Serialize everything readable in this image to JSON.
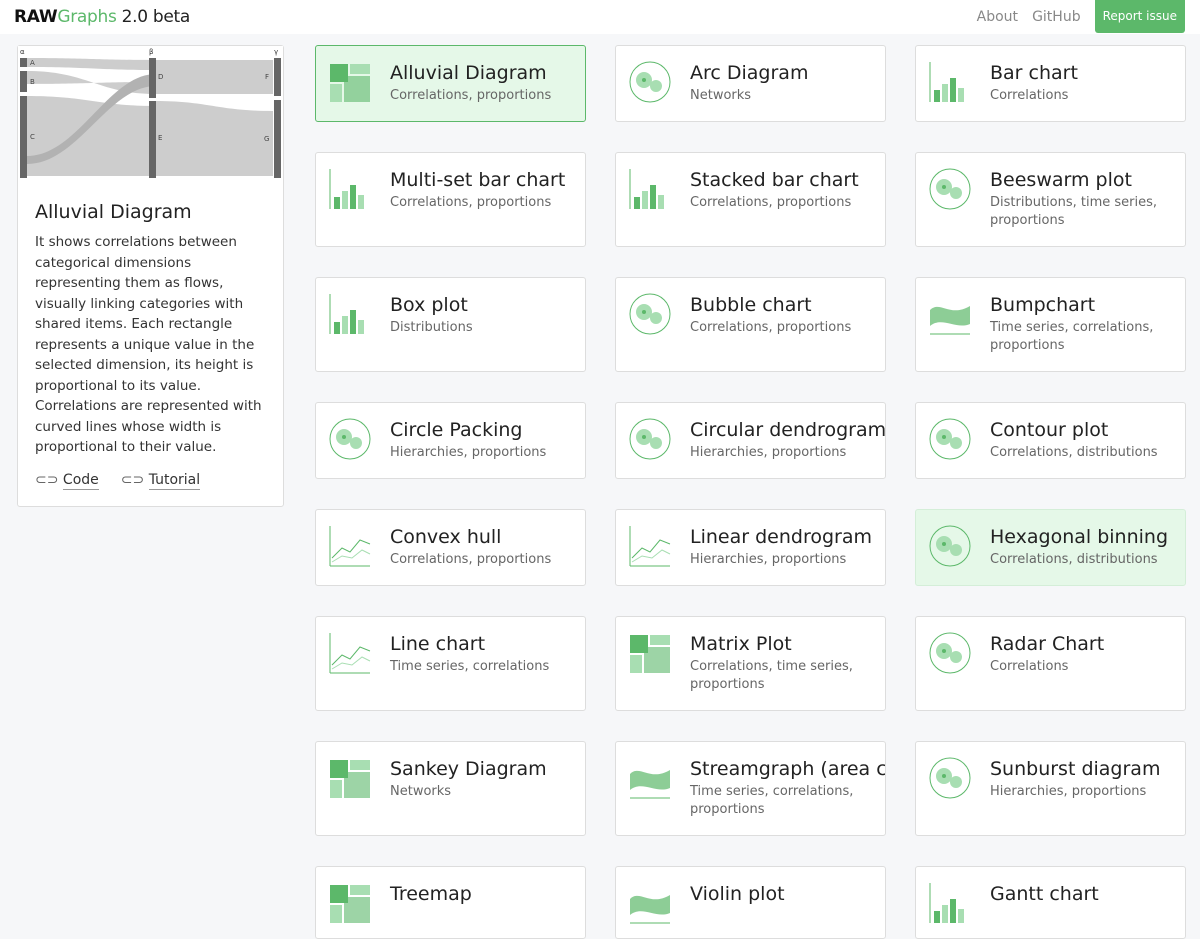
{
  "header": {
    "logo_bold": "RAW",
    "logo_green": "Graphs",
    "logo_version": " 2.0 beta",
    "nav": [
      "About",
      "GitHub"
    ],
    "report": "Report issue"
  },
  "preview": {
    "dims": [
      "α",
      "β",
      "γ"
    ],
    "nodes": [
      "A",
      "B",
      "C",
      "D",
      "E",
      "F",
      "G"
    ],
    "title": "Alluvial Diagram",
    "description": "It shows correlations between categorical dimensions representing them as flows, visually linking categories with shared items. Each rectangle represents a unique value in the selected dimension, its height is proportional to its value. Correlations are represented with curved lines whose width is proportional to their value.",
    "links": [
      "Code",
      "Tutorial"
    ]
  },
  "colors": {
    "accent": "#5cb86a",
    "light": "#a8deb2"
  },
  "charts": [
    {
      "title": "Alluvial Diagram",
      "sub": "Correlations, proportions",
      "icon": "alluvial-icon",
      "state": "selected"
    },
    {
      "title": "Arc Diagram",
      "sub": "Networks",
      "icon": "arc-icon"
    },
    {
      "title": "Bar chart",
      "sub": "Correlations",
      "icon": "bar-icon"
    },
    {
      "title": "Multi-set bar chart",
      "sub": "Correlations, proportions",
      "icon": "multiset-bar-icon"
    },
    {
      "title": "Stacked bar chart",
      "sub": "Correlations, proportions",
      "icon": "stacked-bar-icon"
    },
    {
      "title": "Beeswarm plot",
      "sub": "Distributions, time series, proportions",
      "icon": "beeswarm-icon"
    },
    {
      "title": "Box plot",
      "sub": "Distributions",
      "icon": "boxplot-icon"
    },
    {
      "title": "Bubble chart",
      "sub": "Correlations, proportions",
      "icon": "bubble-icon"
    },
    {
      "title": "Bumpchart",
      "sub": "Time series, correlations, proportions",
      "icon": "bump-icon"
    },
    {
      "title": "Circle Packing",
      "sub": "Hierarchies, proportions",
      "icon": "circle-packing-icon"
    },
    {
      "title": "Circular dendrogram",
      "sub": "Hierarchies, proportions",
      "icon": "circular-dendrogram-icon"
    },
    {
      "title": "Contour plot",
      "sub": "Correlations, distributions",
      "icon": "contour-icon"
    },
    {
      "title": "Convex hull",
      "sub": "Correlations, proportions",
      "icon": "convex-hull-icon"
    },
    {
      "title": "Linear dendrogram",
      "sub": "Hierarchies, proportions",
      "icon": "linear-dendrogram-icon"
    },
    {
      "title": "Hexagonal binning",
      "sub": "Correlations, distributions",
      "icon": "hexbin-icon",
      "state": "hover"
    },
    {
      "title": "Line chart",
      "sub": "Time series, correlations",
      "icon": "line-icon"
    },
    {
      "title": "Matrix Plot",
      "sub": "Correlations, time series, proportions",
      "icon": "matrix-icon"
    },
    {
      "title": "Radar Chart",
      "sub": "Correlations",
      "icon": "radar-icon"
    },
    {
      "title": "Sankey Diagram",
      "sub": "Networks",
      "icon": "sankey-icon"
    },
    {
      "title": "Streamgraph (area chart)",
      "sub": "Time series, correlations, proportions",
      "icon": "streamgraph-icon"
    },
    {
      "title": "Sunburst diagram",
      "sub": "Hierarchies, proportions",
      "icon": "sunburst-icon"
    },
    {
      "title": "Treemap",
      "sub": "",
      "icon": "treemap-icon"
    },
    {
      "title": "Violin plot",
      "sub": "",
      "icon": "violin-icon"
    },
    {
      "title": "Gantt chart",
      "sub": "",
      "icon": "gantt-icon"
    }
  ]
}
